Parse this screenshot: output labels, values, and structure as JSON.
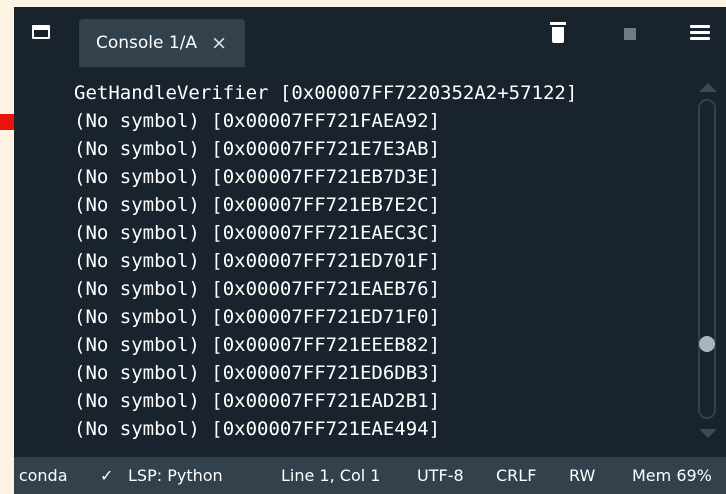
{
  "tab": {
    "title": "Console 1/A",
    "close_glyph": "×"
  },
  "icons": {
    "undock": "undock-icon",
    "trash": "trash-icon",
    "stop": "stop-icon",
    "menu": "menu-icon"
  },
  "console": {
    "lines": [
      "GetHandleVerifier [0x00007FF7220352A2+57122]",
      "(No symbol) [0x00007FF721FAEA92]",
      "(No symbol) [0x00007FF721E7E3AB]",
      "(No symbol) [0x00007FF721EB7D3E]",
      "(No symbol) [0x00007FF721EB7E2C]",
      "(No symbol) [0x00007FF721EAEC3C]",
      "(No symbol) [0x00007FF721ED701F]",
      "(No symbol) [0x00007FF721EAEB76]",
      "(No symbol) [0x00007FF721ED71F0]",
      "(No symbol) [0x00007FF721EEEB82]",
      "(No symbol) [0x00007FF721ED6DB3]",
      "(No symbol) [0x00007FF721EAD2B1]",
      "(No symbol) [0x00007FF721EAE494]"
    ]
  },
  "status": {
    "env": "s: conda",
    "check_glyph": "✓",
    "lsp": "LSP: Python",
    "cursor": "Line 1, Col 1",
    "encoding": "UTF-8",
    "eol": "CRLF",
    "mode": "RW",
    "mem": "Mem 69%"
  },
  "colors": {
    "page_bg": "#fdf3e3",
    "pane_bg": "#19232d",
    "tab_bg": "#32414b",
    "status_bg": "#32414b",
    "arrow": "#e8140c"
  }
}
